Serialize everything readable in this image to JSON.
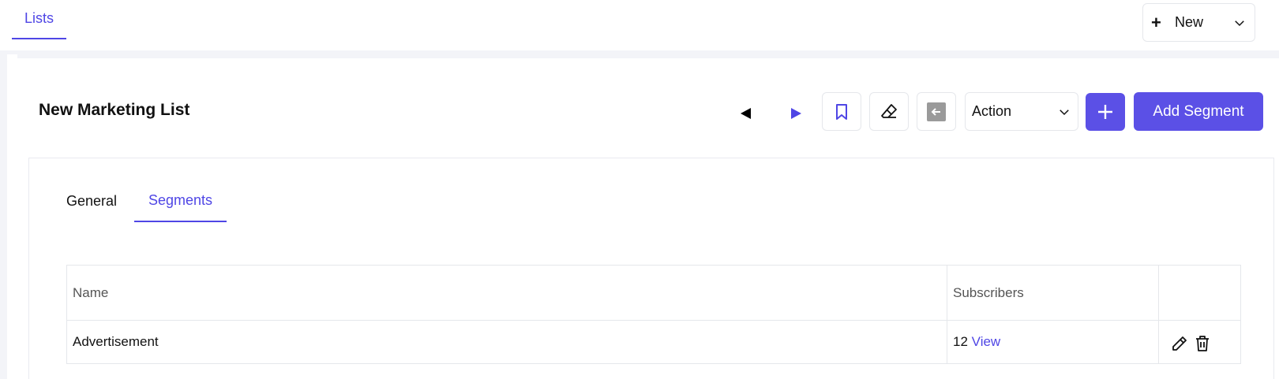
{
  "header": {
    "tab_label": "Lists",
    "new_button_label": "New"
  },
  "toolbar": {
    "title": "New Marketing List",
    "action_select_value": "Action",
    "add_segment_label": "Add Segment"
  },
  "tabs": [
    {
      "label": "General",
      "active": false
    },
    {
      "label": "Segments",
      "active": true
    }
  ],
  "table": {
    "columns": [
      "Name",
      "Subscribers",
      ""
    ],
    "rows": [
      {
        "name": "Advertisement",
        "subscribers": "12",
        "link": "View"
      }
    ]
  },
  "colors": {
    "accent": "#4f46e5",
    "button_bg": "#5b50e6"
  }
}
